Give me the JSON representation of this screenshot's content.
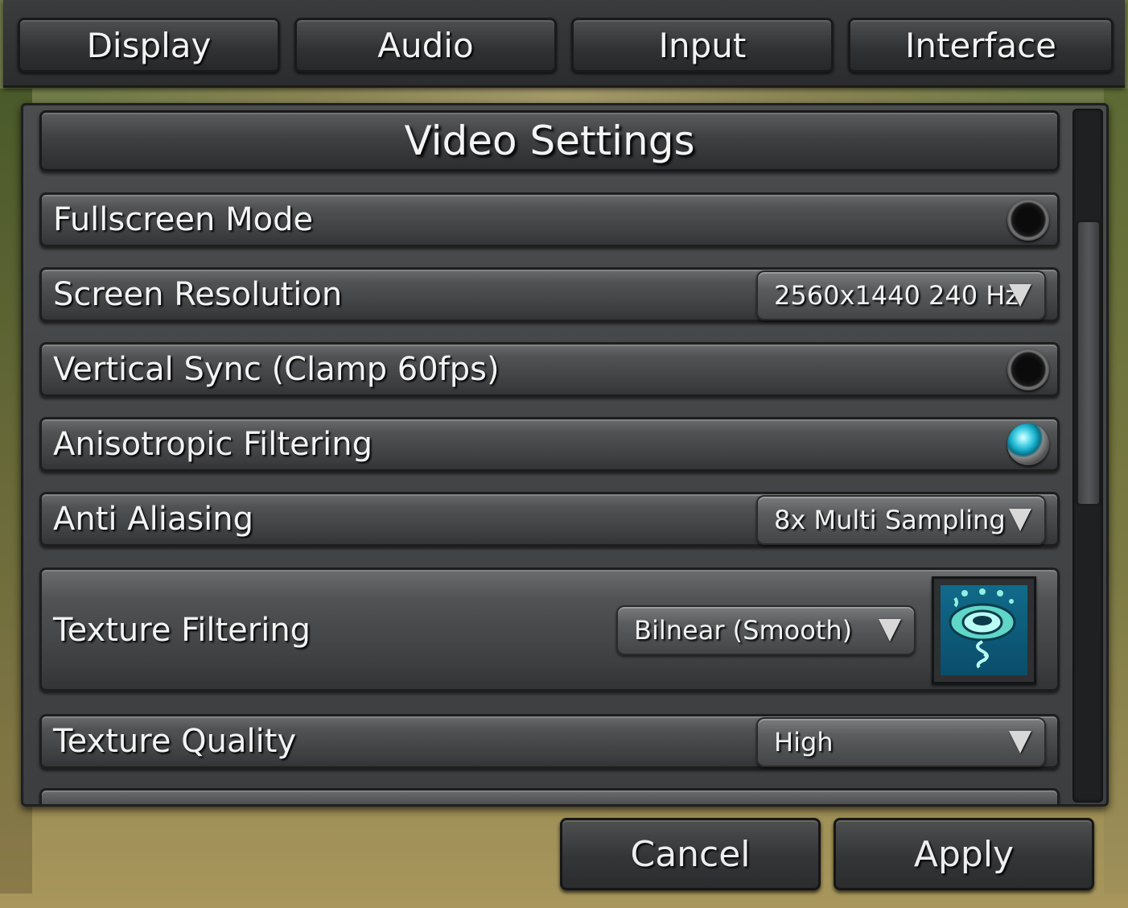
{
  "tabs": [
    {
      "label": "Display"
    },
    {
      "label": "Audio"
    },
    {
      "label": "Input"
    },
    {
      "label": "Interface"
    }
  ],
  "panel": {
    "title": "Video Settings",
    "settings": {
      "fullscreen": {
        "label": "Fullscreen Mode",
        "enabled": false
      },
      "resolution": {
        "label": "Screen Resolution",
        "value": "2560x1440 240 Hz"
      },
      "vsync": {
        "label": "Vertical Sync (Clamp 60fps)",
        "enabled": false
      },
      "anisotropic": {
        "label": "Anisotropic Filtering",
        "enabled": true
      },
      "antialiasing": {
        "label": "Anti Aliasing",
        "value": "8x Multi Sampling"
      },
      "texture_filtering": {
        "label": "Texture Filtering",
        "value": "Bilnear (Smooth)"
      },
      "texture_quality": {
        "label": "Texture Quality",
        "value": "High"
      }
    }
  },
  "buttons": {
    "cancel": "Cancel",
    "apply": "Apply"
  },
  "colors": {
    "toggle_on": "#1ab2cc",
    "toggle_off": "#0b0b0b",
    "text": "#f3f3f3"
  },
  "icons": {
    "preview": "eye-spiral-icon",
    "dropdown": "triangle-down-icon"
  }
}
